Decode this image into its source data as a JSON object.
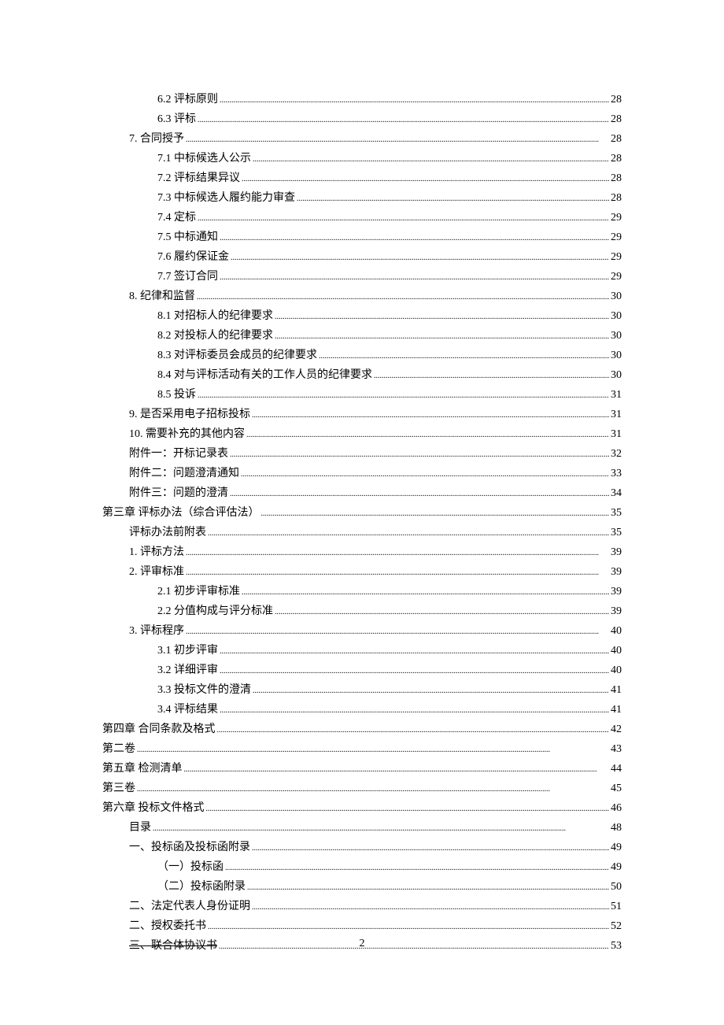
{
  "page_number": "2",
  "entries": [
    {
      "indent": 3,
      "label": "6.2 评标原则",
      "page": "28",
      "strike": false
    },
    {
      "indent": 3,
      "label": "6.3 评标",
      "page": "28",
      "strike": false
    },
    {
      "indent": 2,
      "label": "7. 合同授予",
      "page": "28",
      "strike": false
    },
    {
      "indent": 3,
      "label": "7.1 中标候选人公示",
      "page": "28",
      "strike": false
    },
    {
      "indent": 3,
      "label": "7.2 评标结果异议",
      "page": "28",
      "strike": false
    },
    {
      "indent": 3,
      "label": "7.3 中标候选人履约能力审查",
      "page": "28",
      "strike": false
    },
    {
      "indent": 3,
      "label": "7.4 定标",
      "page": "29",
      "strike": false
    },
    {
      "indent": 3,
      "label": "7.5 中标通知",
      "page": "29",
      "strike": false
    },
    {
      "indent": 3,
      "label": "7.6 履约保证金",
      "page": "29",
      "strike": false
    },
    {
      "indent": 3,
      "label": "7.7 签订合同",
      "page": "29",
      "strike": false
    },
    {
      "indent": 2,
      "label": "8. 纪律和监督",
      "page": "30",
      "strike": false
    },
    {
      "indent": 3,
      "label": "8.1 对招标人的纪律要求",
      "page": "30",
      "strike": false
    },
    {
      "indent": 3,
      "label": "8.2 对投标人的纪律要求",
      "page": "30",
      "strike": false
    },
    {
      "indent": 3,
      "label": "8.3 对评标委员会成员的纪律要求",
      "page": "30",
      "strike": false
    },
    {
      "indent": 3,
      "label": "8.4 对与评标活动有关的工作人员的纪律要求",
      "page": "30",
      "strike": false
    },
    {
      "indent": 3,
      "label": "8.5 投诉",
      "page": "31",
      "strike": false
    },
    {
      "indent": 2,
      "label": "9. 是否采用电子招标投标",
      "page": "31",
      "strike": false
    },
    {
      "indent": 2,
      "label": "10. 需要补充的其他内容",
      "page": "31",
      "strike": false
    },
    {
      "indent": 2,
      "label": "附件一：开标记录表",
      "page": "32",
      "strike": false
    },
    {
      "indent": 2,
      "label": "附件二：问题澄清通知",
      "page": "33",
      "strike": false
    },
    {
      "indent": 2,
      "label": "附件三：问题的澄清",
      "page": "34",
      "strike": false
    },
    {
      "indent": 0,
      "label": "第三章 评标办法（综合评估法）",
      "page": "35",
      "strike": false
    },
    {
      "indent": 1,
      "label": "评标办法前附表",
      "page": "35",
      "strike": false
    },
    {
      "indent": 1,
      "label": "1. 评标方法",
      "page": "39",
      "strike": false
    },
    {
      "indent": 1,
      "label": "2. 评审标准",
      "page": "39",
      "strike": false
    },
    {
      "indent": 3,
      "label": "2.1 初步评审标准",
      "page": "39",
      "strike": false
    },
    {
      "indent": 3,
      "label": "2.2 分值构成与评分标准",
      "page": "39",
      "strike": false
    },
    {
      "indent": 1,
      "label": "3. 评标程序",
      "page": "40",
      "strike": false
    },
    {
      "indent": 3,
      "label": "3.1 初步评审",
      "page": "40",
      "strike": false
    },
    {
      "indent": 3,
      "label": "3.2 详细评审",
      "page": "40",
      "strike": false
    },
    {
      "indent": 3,
      "label": "3.3 投标文件的澄清",
      "page": "41",
      "strike": false
    },
    {
      "indent": 3,
      "label": "3.4 评标结果",
      "page": "41",
      "strike": false
    },
    {
      "indent": 0,
      "label": "第四章 合同条款及格式",
      "page": "42",
      "strike": false
    },
    {
      "indent": 0,
      "label": "第二卷",
      "page": "43",
      "strike": false
    },
    {
      "indent": 0,
      "label": "第五章 检测清单",
      "page": "44",
      "strike": false
    },
    {
      "indent": 0,
      "label": "第三卷",
      "page": "45",
      "strike": false
    },
    {
      "indent": 0,
      "label": "第六章 投标文件格式",
      "page": "46",
      "strike": false
    },
    {
      "indent": 1,
      "label": "目录",
      "page": "48",
      "strike": false
    },
    {
      "indent": 1,
      "label": "一、投标函及投标函附录",
      "page": "49",
      "strike": false
    },
    {
      "indent": 3,
      "label": "（一）投标函",
      "page": "49",
      "strike": false
    },
    {
      "indent": 3,
      "label": "（二）投标函附录",
      "page": "50",
      "strike": false
    },
    {
      "indent": 1,
      "label": "二、法定代表人身份证明",
      "page": "51",
      "strike": false
    },
    {
      "indent": 1,
      "label": "二、授权委托书",
      "page": "52",
      "strike": false
    },
    {
      "indent": 1,
      "label": "三、联合体协议书",
      "page": "53",
      "strike": true
    }
  ]
}
